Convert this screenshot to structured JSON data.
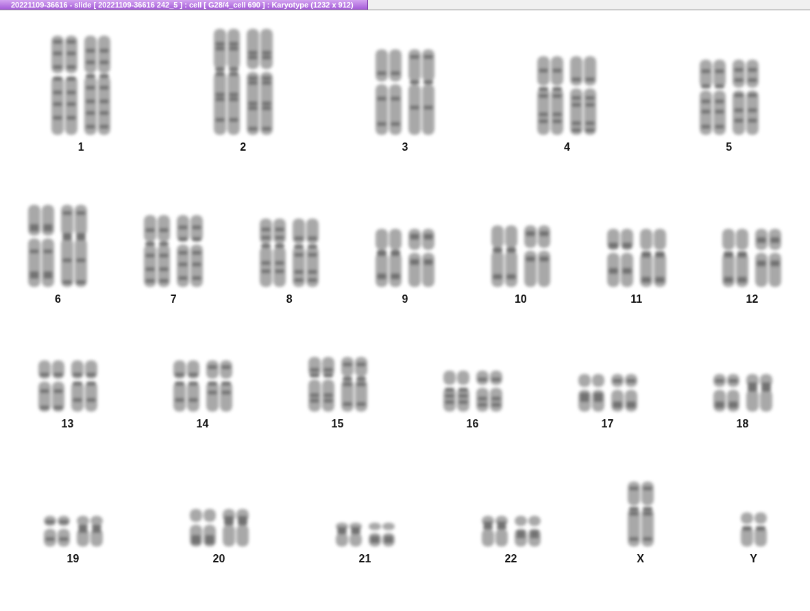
{
  "window": {
    "title": "20221109-36616 - slide [ 20221109-36616 242_5 ] : cell [ G28/4_cell 690 ] : Karyotype  (1232 x 912)"
  },
  "rows": [
    {
      "items": [
        {
          "label": "1",
          "kind": "pair"
        },
        {
          "label": "2",
          "kind": "pair"
        },
        {
          "label": "3",
          "kind": "pair"
        },
        {
          "label": "4",
          "kind": "pair"
        },
        {
          "label": "5",
          "kind": "pair"
        }
      ]
    },
    {
      "items": [
        {
          "label": "6",
          "kind": "pair"
        },
        {
          "label": "7",
          "kind": "pair"
        },
        {
          "label": "8",
          "kind": "pair"
        },
        {
          "label": "9",
          "kind": "pair"
        },
        {
          "label": "10",
          "kind": "pair"
        },
        {
          "label": "11",
          "kind": "pair"
        },
        {
          "label": "12",
          "kind": "pair"
        }
      ]
    },
    {
      "items": [
        {
          "label": "13",
          "kind": "pair"
        },
        {
          "label": "14",
          "kind": "pair"
        },
        {
          "label": "15",
          "kind": "pair"
        },
        {
          "label": "16",
          "kind": "pair"
        },
        {
          "label": "17",
          "kind": "pair"
        },
        {
          "label": "18",
          "kind": "pair"
        }
      ]
    },
    {
      "items": [
        {
          "label": "19",
          "kind": "pair"
        },
        {
          "label": "20",
          "kind": "pair"
        },
        {
          "label": "21",
          "kind": "pair"
        },
        {
          "label": "22",
          "kind": "pair"
        },
        {
          "label": "X",
          "kind": "single"
        },
        {
          "label": "Y",
          "kind": "single"
        }
      ]
    }
  ]
}
